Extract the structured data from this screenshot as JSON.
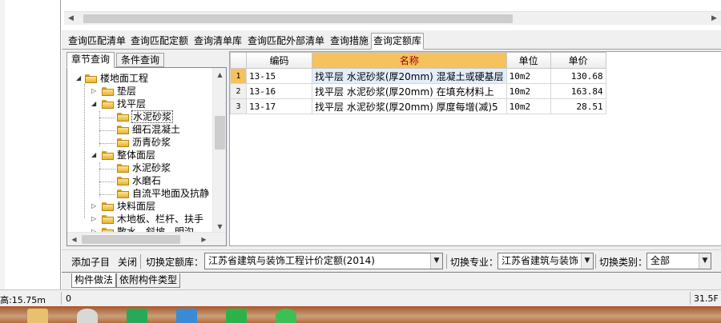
{
  "query_tabs": [
    "查询匹配清单",
    "查询匹配定额",
    "查询清单库",
    "查询匹配外部清单",
    "查询措施",
    "查询定额库"
  ],
  "active_query_tab": "查询定额库",
  "left_tabs": [
    "章节查询",
    "条件查询"
  ],
  "tree": [
    {
      "label": "楼地面工程",
      "level": 0,
      "expanded": true
    },
    {
      "label": "垫层",
      "level": 1,
      "expanded": false
    },
    {
      "label": "找平层",
      "level": 1,
      "expanded": true
    },
    {
      "label": "水泥砂浆",
      "level": 2,
      "selected": true
    },
    {
      "label": "细石混凝土",
      "level": 2
    },
    {
      "label": "沥青砂浆",
      "level": 2
    },
    {
      "label": "整体面层",
      "level": 1,
      "expanded": true
    },
    {
      "label": "水泥砂浆",
      "level": 2
    },
    {
      "label": "水磨石",
      "level": 2
    },
    {
      "label": "自流平地面及抗静",
      "level": 2
    },
    {
      "label": "块料面层",
      "level": 1,
      "expanded": false
    },
    {
      "label": "木地板、栏杆、扶手",
      "level": 1,
      "expanded": false
    },
    {
      "label": "散水、斜坡、明沟",
      "level": 1,
      "expanded": false
    }
  ],
  "table": {
    "columns": [
      "编码",
      "名称",
      "单位",
      "单价"
    ],
    "rows": [
      {
        "no": "1",
        "code": "13-15",
        "name": "找平层 水泥砂浆(厚20mm) 混凝土或硬基层",
        "unit": "10m2",
        "price": "130.68"
      },
      {
        "no": "2",
        "code": "13-16",
        "name": "找平层 水泥砂浆(厚20mm) 在填充材料上",
        "unit": "10m2",
        "price": "163.84"
      },
      {
        "no": "3",
        "code": "13-17",
        "name": "找平层 水泥砂浆(厚20mm) 厚度每增(减)5",
        "unit": "10m2",
        "price": "28.51"
      }
    ]
  },
  "toolbar": {
    "add_child": "添加子目",
    "close": "关闭",
    "switch_lib_label": "切换定额库：",
    "switch_lib_value": "江苏省建筑与装饰工程计价定额(2014)",
    "switch_major_label": "切换专业：",
    "switch_major_value": "江苏省建筑与装饰",
    "switch_type_label": "切换类别：",
    "switch_type_value": "全部"
  },
  "bottom_tabs": [
    "构件做法",
    "依附构件类型"
  ],
  "status": {
    "height": "高:15.75m",
    "value": "0",
    "right": "31.5F"
  },
  "colors": {
    "header_active": "#f6c25e",
    "header_text": "#a00000",
    "selected_row": "#e3eefc"
  },
  "taskbar_icons": [
    "folder-icon",
    "app-icon",
    "green-app-icon",
    "blue-app-icon",
    "green-chat-icon",
    "green-refresh-icon"
  ]
}
